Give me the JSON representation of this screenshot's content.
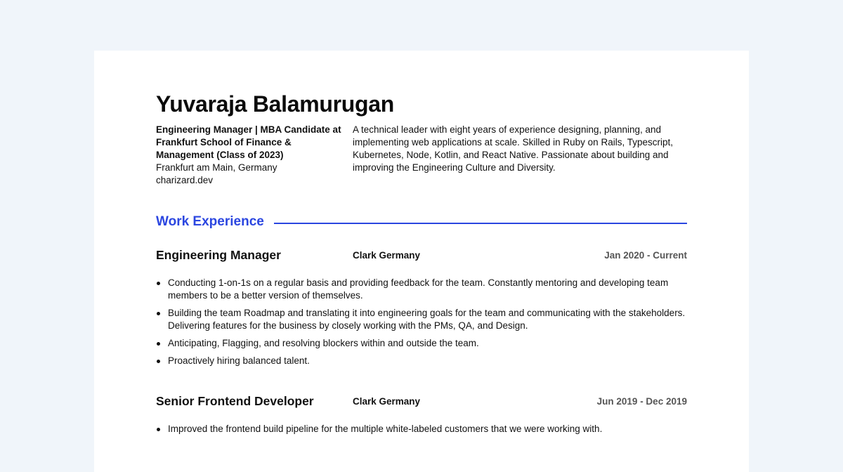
{
  "profile": {
    "name": "Yuvaraja Balamurugan",
    "headline": "Engineering Manager | MBA Candidate at Frankfurt School of Finance & Management (Class of 2023)",
    "location": "Frankfurt am Main, Germany",
    "website": "charizard.dev",
    "summary": "A technical leader with eight years of experience designing, planning, and implementing web applications at scale. Skilled in Ruby on Rails, Typescript, Kubernetes, Node, Kotlin, and React Native. Passionate about building and improving the Engineering Culture and Diversity."
  },
  "work_experience": {
    "title": "Work Experience",
    "accent_color": "#2b46e0",
    "jobs": [
      {
        "title": "Engineering Manager",
        "company": "Clark Germany",
        "dates": "Jan 2020 - Current",
        "bullets": [
          "Conducting 1-on-1s on a regular basis and providing feedback for the team. Constantly mentoring and developing team members to be a better version of themselves.",
          "Building the team Roadmap and translating it into engineering goals for the team and communicating with the stakeholders. Delivering features for the business by closely working with the PMs, QA, and Design.",
          "Anticipating, Flagging, and resolving blockers within and outside the team.",
          "Proactively hiring balanced talent."
        ]
      },
      {
        "title": "Senior Frontend Developer",
        "company": "Clark Germany",
        "dates": "Jun 2019 - Dec 2019",
        "bullets": [
          "Improved the frontend build pipeline for the multiple white-labeled customers that we were working with."
        ]
      }
    ]
  }
}
